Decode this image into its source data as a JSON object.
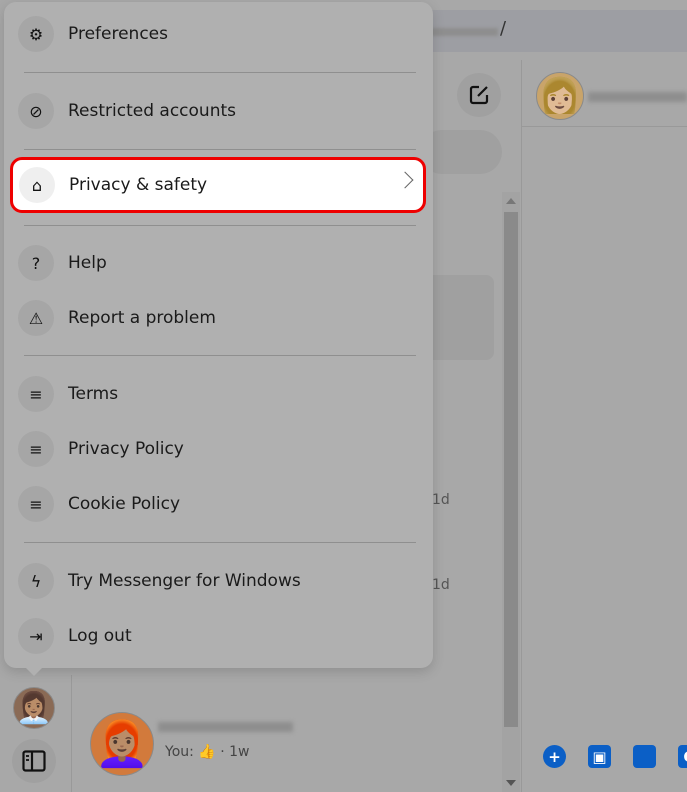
{
  "menu": {
    "items": [
      {
        "label": "Preferences",
        "icon": "gear-icon"
      },
      {
        "label": "Restricted accounts",
        "icon": "restricted-icon"
      },
      {
        "label": "Privacy & safety",
        "icon": "house-lock-icon"
      },
      {
        "label": "Help",
        "icon": "question-icon"
      },
      {
        "label": "Report a problem",
        "icon": "warning-icon"
      },
      {
        "label": "Terms",
        "icon": "lines-icon"
      },
      {
        "label": "Privacy Policy",
        "icon": "lines-icon"
      },
      {
        "label": "Cookie Policy",
        "icon": "lines-icon"
      },
      {
        "label": "Try Messenger for Windows",
        "icon": "messenger-icon"
      },
      {
        "label": "Log out",
        "icon": "logout-icon"
      }
    ]
  },
  "topbar": {
    "slash": "/"
  },
  "chats": {
    "times": [
      "1d",
      "1d"
    ],
    "last_preview": {
      "prefix": "You:",
      "emoji": "👍",
      "time": "· 1w"
    }
  },
  "colors": {
    "highlight_border": "#ee0000",
    "accent": "#0b5fc6"
  }
}
